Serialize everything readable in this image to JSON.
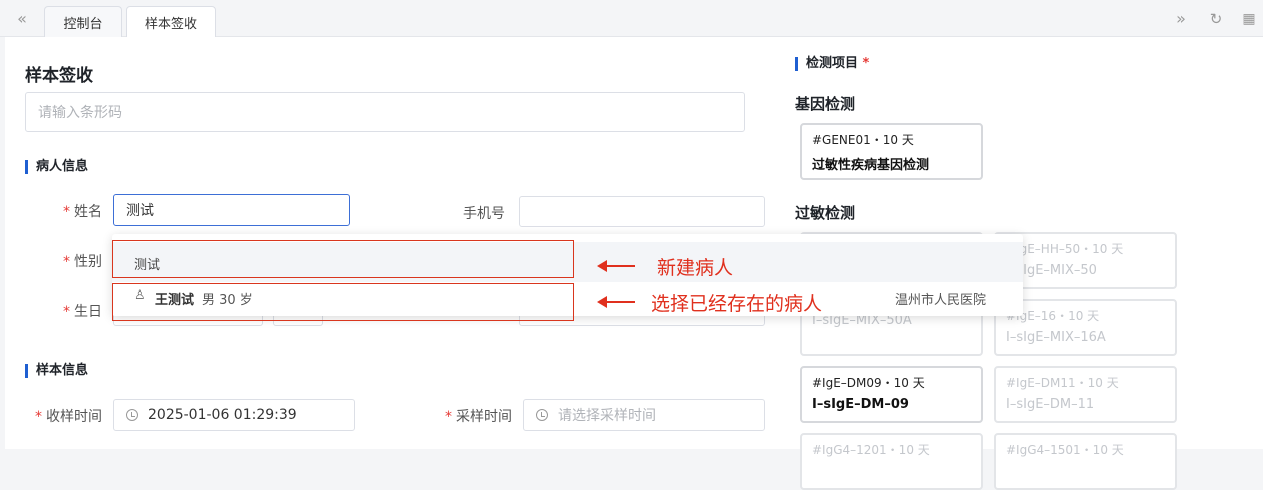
{
  "tabs": [
    {
      "label": "控制台"
    },
    {
      "label": "样本签收"
    }
  ],
  "page_title": "样本签收",
  "barcode": {
    "placeholder": "请输入条形码"
  },
  "patient_section": {
    "title": "病人信息"
  },
  "fields": {
    "name_label": "姓名",
    "name_value": "测试",
    "phone_label": "手机号",
    "phone_value": "",
    "gender_label": "性别",
    "birth_label": "生日"
  },
  "sample_section": {
    "title": "样本信息"
  },
  "sample_fields": {
    "receive_time_label": "收样时间",
    "receive_time_value": "2025-01-06 01:29:39",
    "collect_time_label": "采样时间",
    "collect_time_placeholder": "请选择采样时间"
  },
  "dropdown": {
    "new_option": "测试",
    "existing": {
      "name": "王测试",
      "detail": "男 30 岁",
      "hospital": "温州市人民医院"
    }
  },
  "annotations": {
    "new_patient": "新建病人",
    "select_existing": "选择已经存在的病人"
  },
  "test_items": {
    "title": "检测项目",
    "gene_group": "基因检测",
    "allergy_group": "过敏检测",
    "gene_cards": [
      {
        "code": "#GENE01・10 天",
        "name": "过敏性疾病基因检测"
      }
    ],
    "allergy_cards": [
      {
        "code": "#IgE–HH–50・10 天",
        "name": "I–sIgE–MIX–50"
      },
      {
        "code": "",
        "name": ""
      },
      {
        "code": "#IgE–16・10 天",
        "name": "I–sIgE–MIX–16A"
      },
      {
        "code": "",
        "name": "I–sIgE–MIX–50A"
      },
      {
        "code": "#IgE–DM09・10 天",
        "name": "I–sIgE–DM–09"
      },
      {
        "code": "#IgE–DM11・10 天",
        "name": "I–sIgE–DM–11"
      },
      {
        "code": "#IgG4–1201・10 天",
        "name": ""
      },
      {
        "code": "#IgG4–1501・10 天",
        "name": ""
      }
    ]
  }
}
